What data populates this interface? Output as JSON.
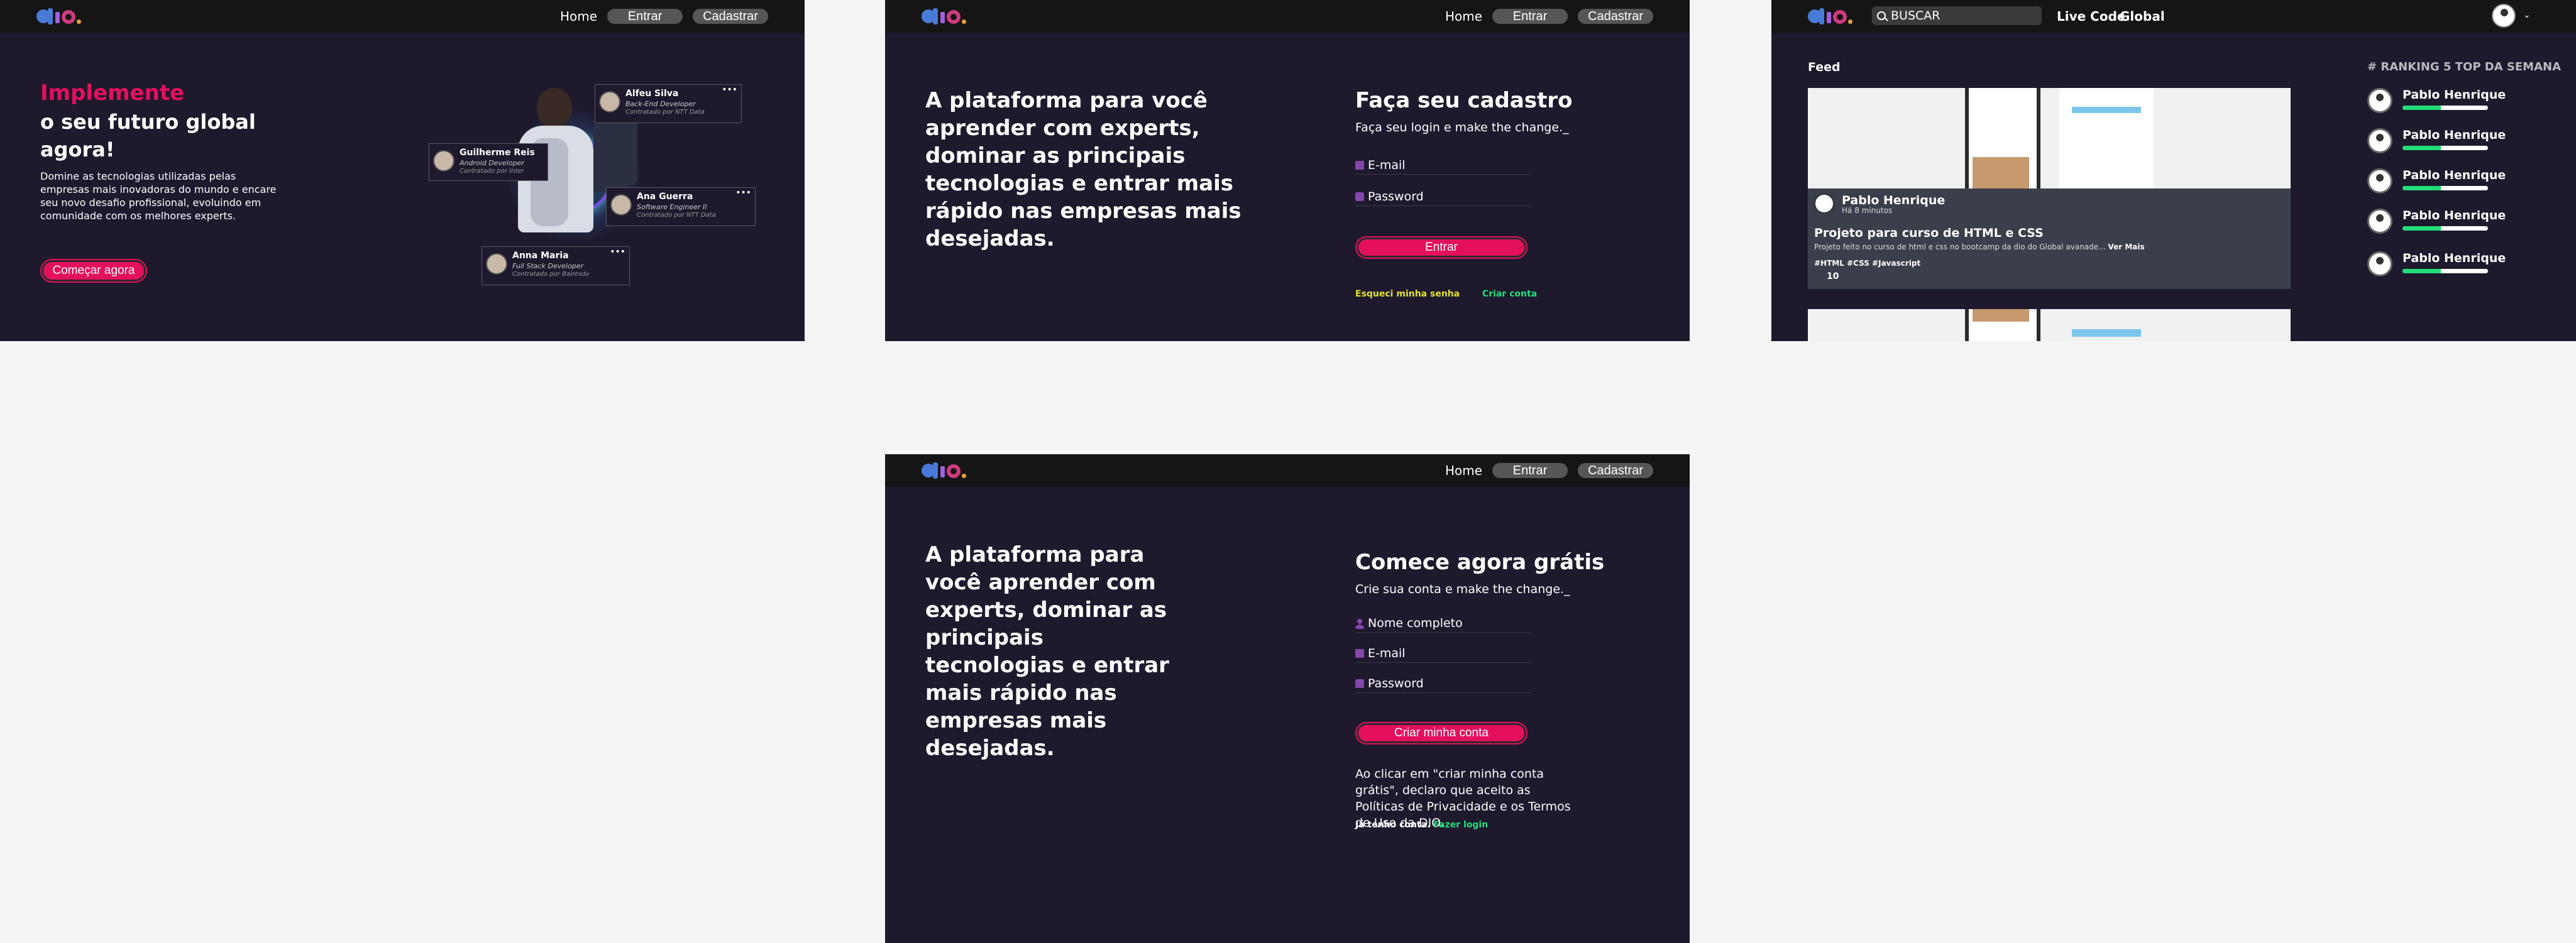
{
  "nav": {
    "home": "Home",
    "entrar": "Entrar",
    "cadastrar": "Cadastrar"
  },
  "landing": {
    "title_highlight": "Implemente",
    "title_rest": "o seu futuro global agora!",
    "description": "Domine as tecnologias utilizadas pelas empresas mais inovadoras do mundo e encare seu novo desafio profissional, evoluindo em comunidade com os melhores experts.",
    "cta": "Começar agora",
    "cards": [
      {
        "name": "Alfeu Silva",
        "role": "Back-End Developer",
        "company": "Contratado por NTT Data"
      },
      {
        "name": "Guilherme Reis",
        "role": "Android Developer",
        "company": "Contratado por Inter"
      },
      {
        "name": "Ana Guerra",
        "role": "Software Engineer II",
        "company": "Contratado por NTT Data"
      },
      {
        "name": "Anna Maria",
        "role": "Full Stack Developer",
        "company": "Contratado por Bairesdv"
      }
    ],
    "card_menu": "•••"
  },
  "login": {
    "headline": "A plataforma para você aprender com experts, dominar as principais tecnologias e entrar mais rápido nas empresas mais desejadas.",
    "title": "Faça seu cadastro",
    "subtitle": "Faça seu login e make the change._",
    "email_placeholder": "E-mail",
    "password_placeholder": "Password",
    "submit": "Entrar",
    "forgot": "Esqueci minha senha",
    "create": "Criar conta"
  },
  "feed": {
    "search_placeholder": "BUSCAR",
    "top_links": [
      "Live Code",
      "Global"
    ],
    "chevron": "⌄",
    "feed_title": "Feed",
    "post": {
      "author": "Pablo Henrique",
      "time": "Há 8 minutos",
      "title": "Projeto para curso de HTML e CSS",
      "description": "Projeto feito no curso de html e css no bootcamp da dio do Global avanade...",
      "see_more": "Ver Mais",
      "tags": "#HTML #CSS #Javascript",
      "likes": "10"
    },
    "ranking_title": "# RANKING 5 TOP DA SEMANA",
    "ranking": [
      {
        "name": "Pablo Henrique",
        "progress": 0.45
      },
      {
        "name": "Pablo Henrique",
        "progress": 0.45
      },
      {
        "name": "Pablo Henrique",
        "progress": 0.45
      },
      {
        "name": "Pablo Henrique",
        "progress": 0.45
      },
      {
        "name": "Pablo Henrique",
        "progress": 0.45
      }
    ]
  },
  "signup": {
    "headline": "A plataforma para você aprender com experts, dominar as principais tecnologias e entrar mais rápido nas empresas mais desejadas.",
    "title": "Comece agora grátis",
    "subtitle": "Crie sua conta e make the change._",
    "name_placeholder": "Nome completo",
    "email_placeholder": "E-mail",
    "password_placeholder": "Password",
    "submit": "Criar minha conta",
    "terms": "Ao clicar em \"criar minha conta grátis\", declaro que aceito as Políticas de Privacidade e os Termos de Uso da DIO.",
    "has_account": "Já tenho conta.",
    "login_link": "Fazer login"
  },
  "colors": {
    "bg": "#1e192c",
    "header": "#151515",
    "accent": "#e4105d",
    "green": "#23dd7a",
    "yellow": "#e4e22e",
    "icon": "#8647ad"
  }
}
